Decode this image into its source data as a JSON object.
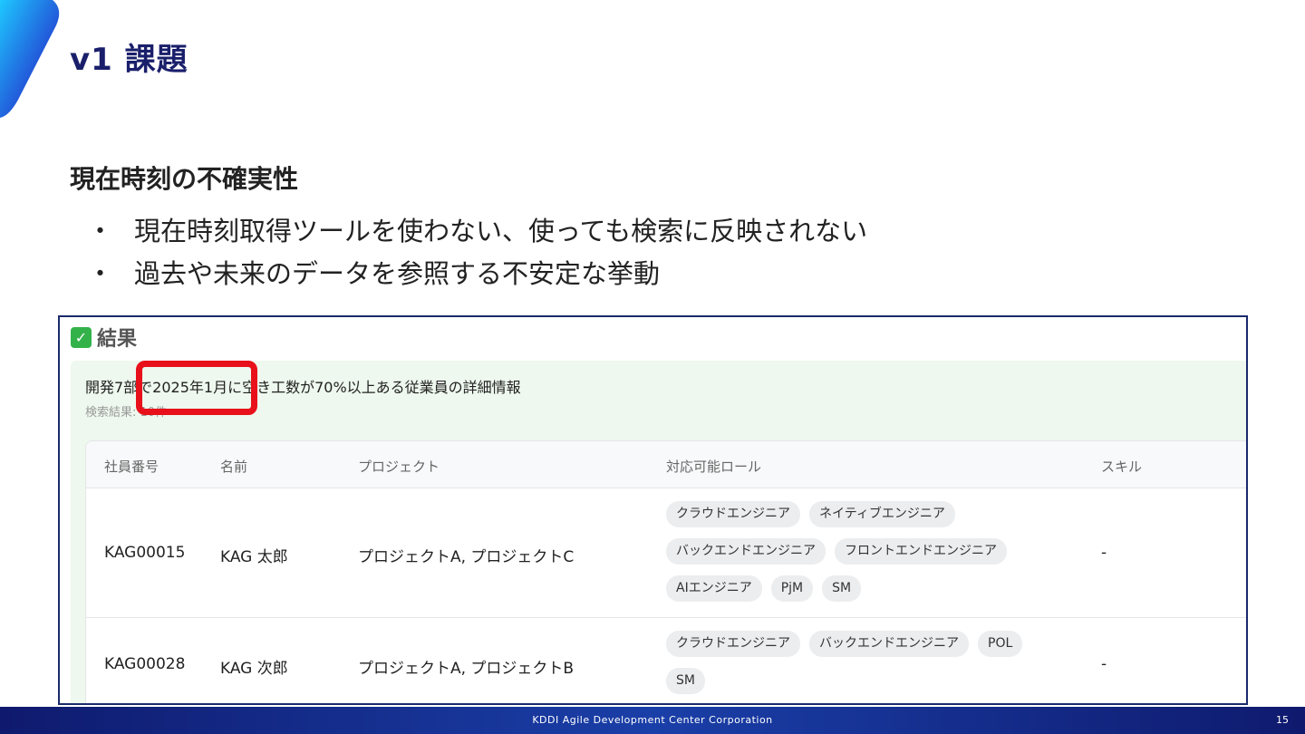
{
  "slide": {
    "title": "v1 課題",
    "heading": "現在時刻の不確実性",
    "bullets": [
      "現在時刻取得ツールを使わない、使っても検索に反映されない",
      "過去や未来のデータを参照する不安定な挙動"
    ],
    "bullet_mark": "・",
    "footer": "KDDI Agile Development Center Corporation",
    "page_number": "15"
  },
  "result": {
    "title": "結果",
    "icon": "check-icon",
    "query": "開発7部で2025年1月に空き工数が70%以上ある従業員の詳細情報",
    "count": "検索結果: 10件",
    "columns": [
      "社員番号",
      "名前",
      "プロジェクト",
      "対応可能ロール",
      "スキル"
    ],
    "rows": [
      {
        "id": "KAG00015",
        "name": "KAG 太郎",
        "projects": "プロジェクトA, プロジェクトC",
        "roles": [
          "クラウドエンジニア",
          "ネイティブエンジニア",
          "バックエンドエンジニア",
          "フロントエンドエンジニア",
          "AIエンジニア",
          "PjM",
          "SM"
        ],
        "skills": "-"
      },
      {
        "id": "KAG00028",
        "name": "KAG 次郎",
        "projects": "プロジェクトA, プロジェクトB",
        "roles": [
          "クラウドエンジニア",
          "バックエンドエンジニア",
          "POL",
          "SM"
        ],
        "skills": "-"
      }
    ]
  },
  "colors": {
    "title": "#1a1f6b",
    "highlight": "#e8101a",
    "panel": "#eef8ee",
    "check": "#33b24a"
  }
}
